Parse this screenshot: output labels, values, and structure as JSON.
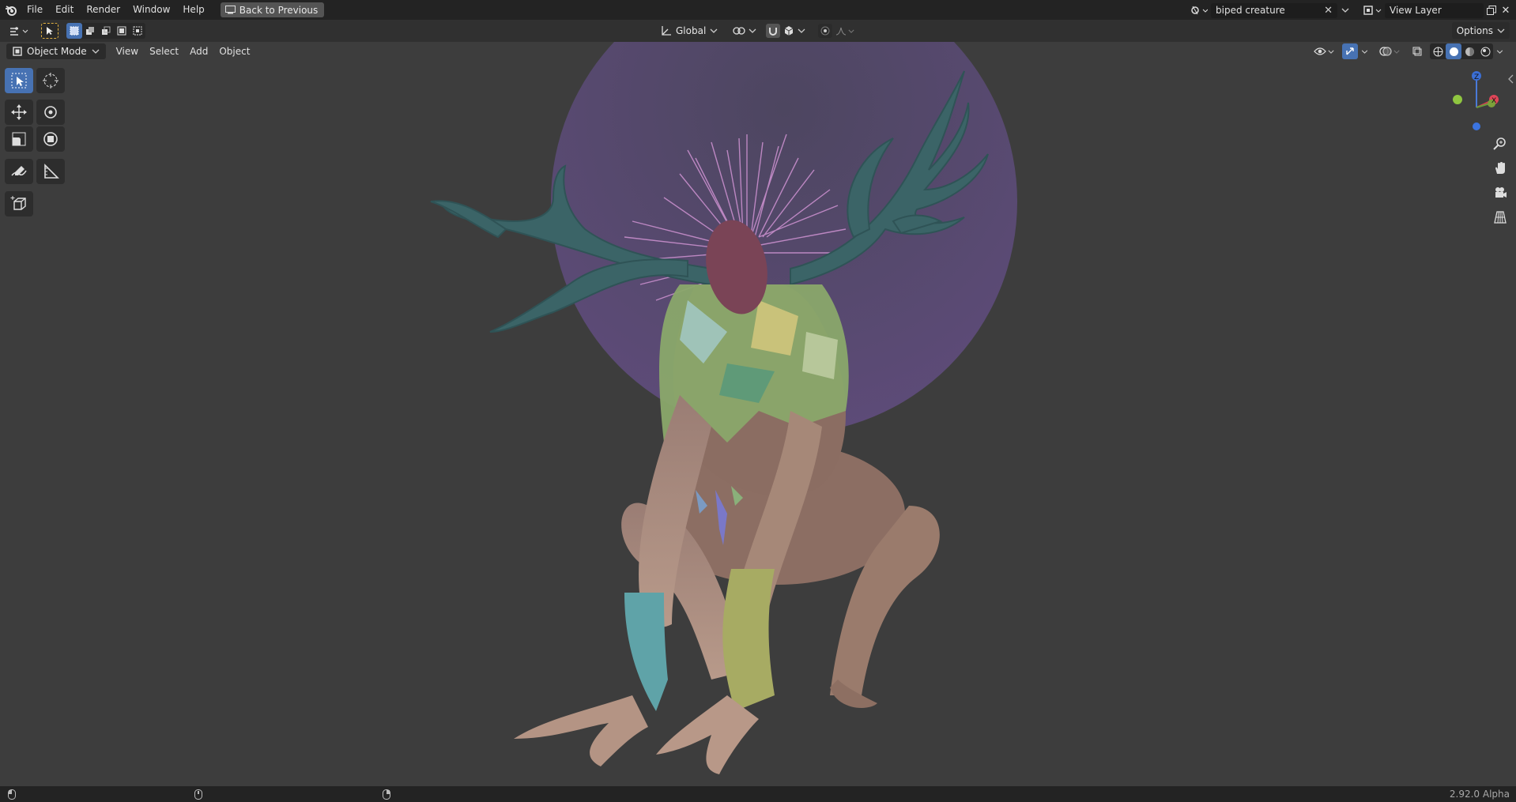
{
  "menu": {
    "file": "File",
    "edit": "Edit",
    "render": "Render",
    "window": "Window",
    "help": "Help",
    "back_button": "Back to Previous"
  },
  "scene": {
    "name": "biped creature",
    "view_layer": "View Layer"
  },
  "header": {
    "transform_orientation": "Global",
    "options": "Options"
  },
  "viewport_header": {
    "mode": "Object Mode",
    "view": "View",
    "select": "Select",
    "add": "Add",
    "object": "Object"
  },
  "gizmo": {
    "z": "Z",
    "x": "X"
  },
  "status": {
    "version": "2.92.0 Alpha"
  },
  "colors": {
    "accent": "#4772b3",
    "moon": "#5a4a72",
    "antler": "#3a6468",
    "skin": "#a98a7c",
    "hair": "#c48ac9"
  }
}
